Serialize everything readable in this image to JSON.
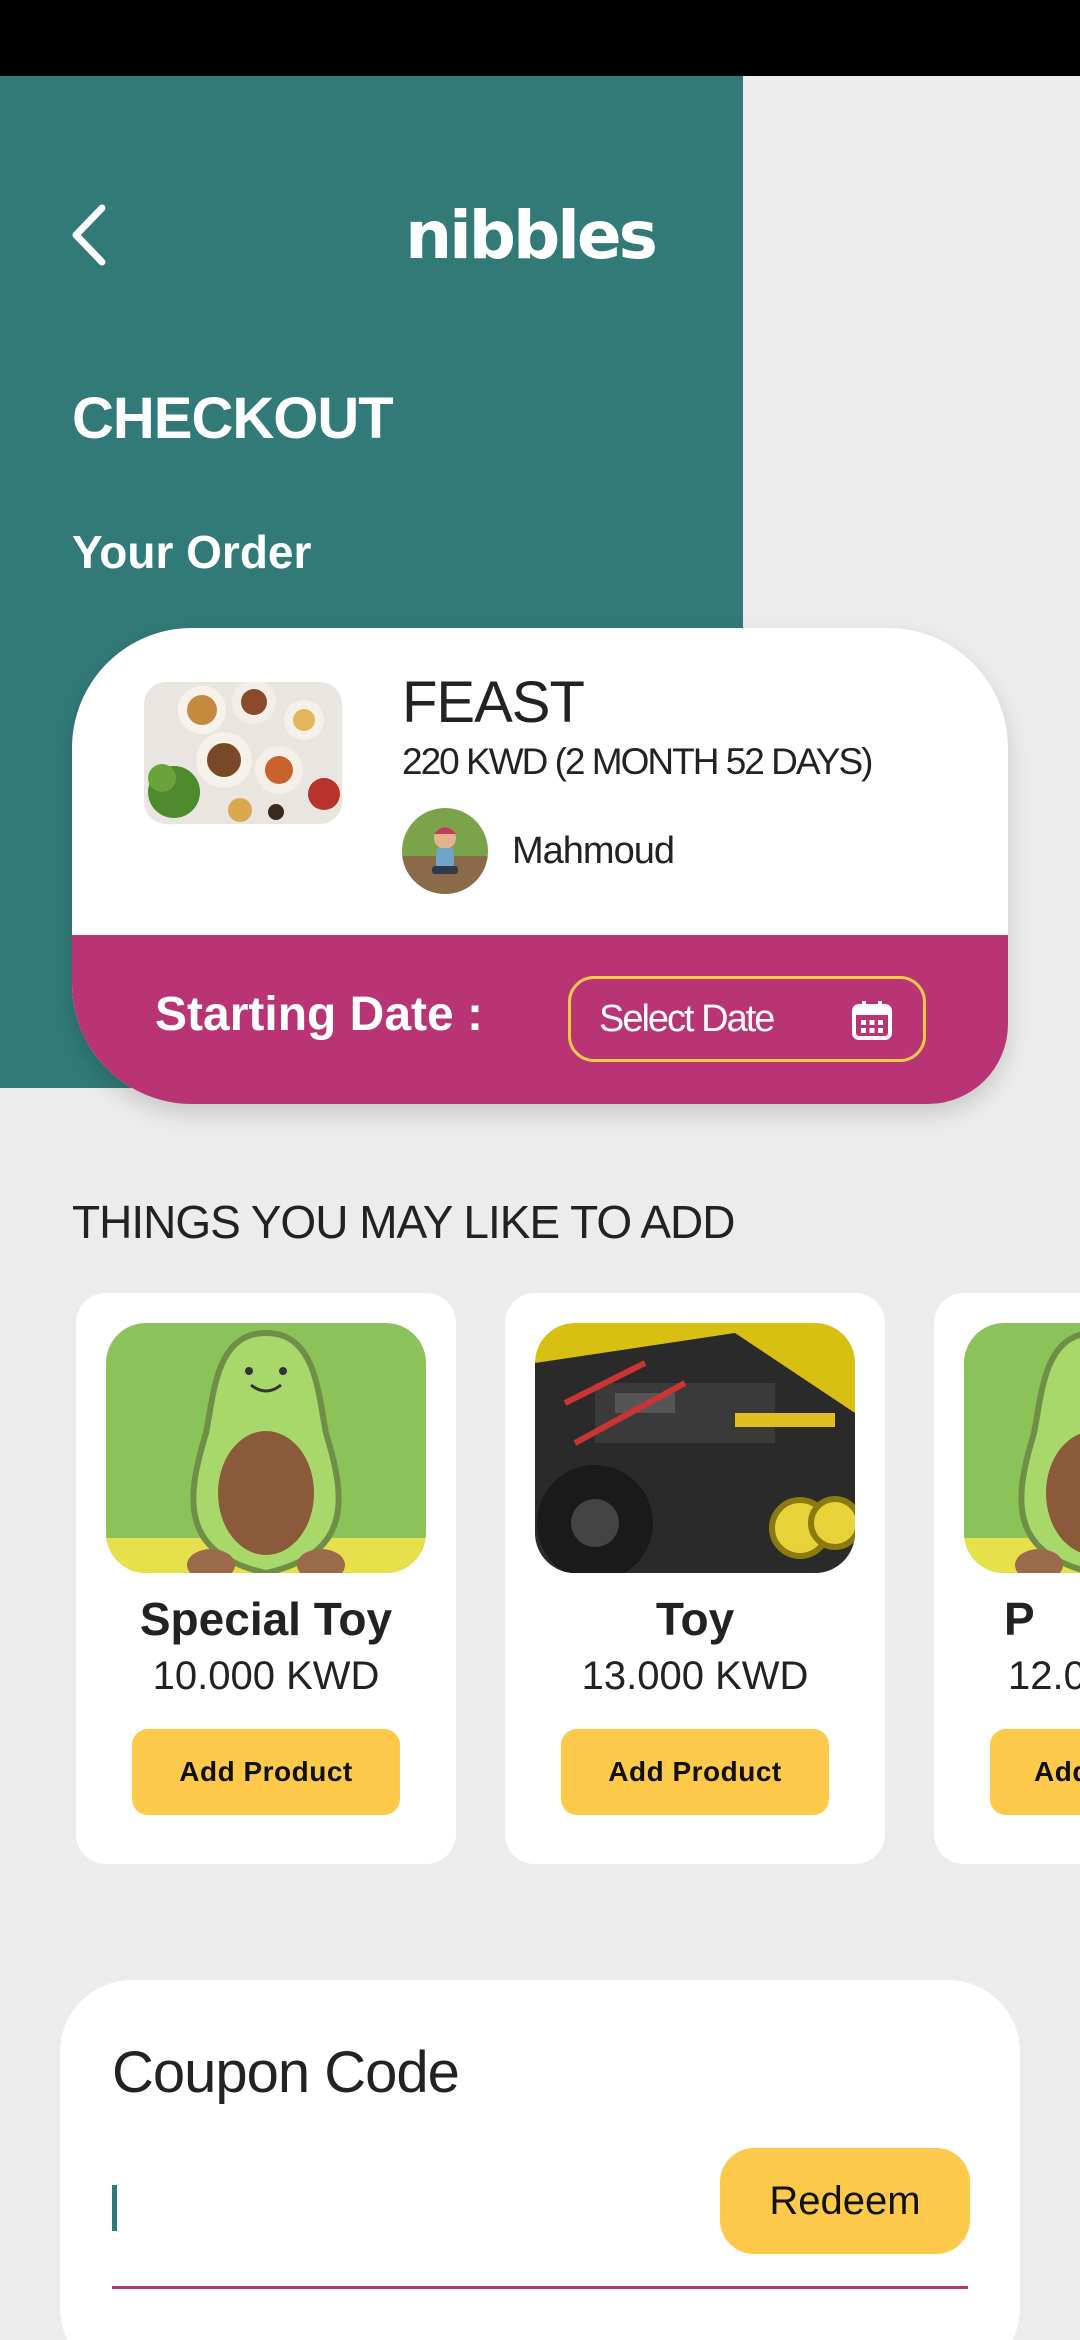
{
  "app": {
    "logo_text": "nibbles"
  },
  "header": {
    "title": "CHECKOUT",
    "subtitle": "Your Order"
  },
  "order": {
    "name": "FEAST",
    "price": "220 KWD (2 MONTH 52 DAYS)",
    "child_name": "Mahmoud",
    "starting_date_label": "Starting Date :",
    "select_date_label": "Select Date"
  },
  "suggestions": {
    "title": "THINGS YOU MAY LIKE TO ADD",
    "items": [
      {
        "name": "Special Toy",
        "price": "10.000 KWD",
        "button": "Add Product"
      },
      {
        "name": "Toy",
        "price": "13.000 KWD",
        "button": "Add Product"
      },
      {
        "name": "P",
        "price": "12.0",
        "button": "Add"
      }
    ]
  },
  "coupon": {
    "title": "Coupon Code",
    "value": "",
    "redeem_label": "Redeem"
  },
  "colors": {
    "teal": "#317a78",
    "magenta": "#b83474",
    "yellow": "#fcc94a",
    "background": "#ececec"
  },
  "icons": {
    "back": "chevron-left-icon",
    "calendar": "calendar-icon"
  }
}
